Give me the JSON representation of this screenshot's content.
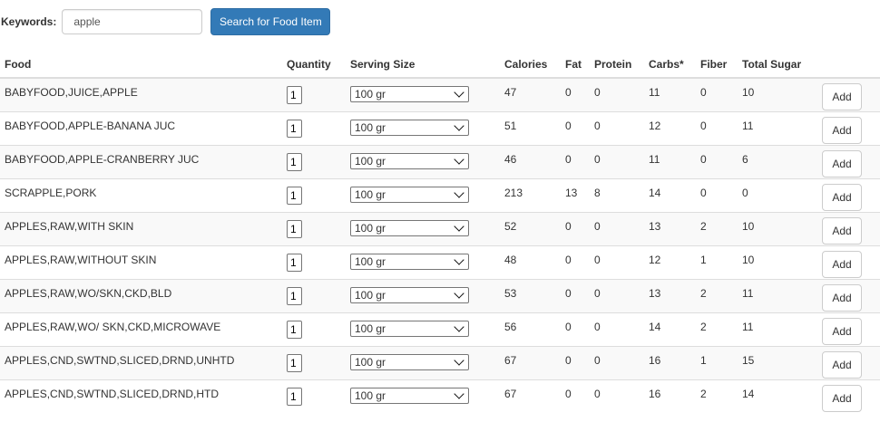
{
  "search": {
    "label": "Keywords:",
    "value": "apple",
    "button_label": "Search for Food Item"
  },
  "columns": {
    "food": "Food",
    "quantity": "Quantity",
    "serving_size": "Serving Size",
    "calories": "Calories",
    "fat": "Fat",
    "protein": "Protein",
    "carbs": "Carbs*",
    "fiber": "Fiber",
    "total_sugar": "Total Sugar"
  },
  "add_label": "Add",
  "rows": [
    {
      "food": "BABYFOOD,JUICE,APPLE",
      "quantity": "1",
      "serving": "100 gr",
      "calories": "47",
      "fat": "0",
      "protein": "0",
      "carbs": "11",
      "fiber": "0",
      "sugar": "10"
    },
    {
      "food": "BABYFOOD,APPLE-BANANA JUC",
      "quantity": "1",
      "serving": "100 gr",
      "calories": "51",
      "fat": "0",
      "protein": "0",
      "carbs": "12",
      "fiber": "0",
      "sugar": "11"
    },
    {
      "food": "BABYFOOD,APPLE-CRANBERRY JUC",
      "quantity": "1",
      "serving": "100 gr",
      "calories": "46",
      "fat": "0",
      "protein": "0",
      "carbs": "11",
      "fiber": "0",
      "sugar": "6"
    },
    {
      "food": "SCRAPPLE,PORK",
      "quantity": "1",
      "serving": "100 gr",
      "calories": "213",
      "fat": "13",
      "protein": "8",
      "carbs": "14",
      "fiber": "0",
      "sugar": "0"
    },
    {
      "food": "APPLES,RAW,WITH SKIN",
      "quantity": "1",
      "serving": "100 gr",
      "calories": "52",
      "fat": "0",
      "protein": "0",
      "carbs": "13",
      "fiber": "2",
      "sugar": "10"
    },
    {
      "food": "APPLES,RAW,WITHOUT SKIN",
      "quantity": "1",
      "serving": "100 gr",
      "calories": "48",
      "fat": "0",
      "protein": "0",
      "carbs": "12",
      "fiber": "1",
      "sugar": "10"
    },
    {
      "food": "APPLES,RAW,WO/SKN,CKD,BLD",
      "quantity": "1",
      "serving": "100 gr",
      "calories": "53",
      "fat": "0",
      "protein": "0",
      "carbs": "13",
      "fiber": "2",
      "sugar": "11"
    },
    {
      "food": "APPLES,RAW,WO/ SKN,CKD,MICROWAVE",
      "quantity": "1",
      "serving": "100 gr",
      "calories": "56",
      "fat": "0",
      "protein": "0",
      "carbs": "14",
      "fiber": "2",
      "sugar": "11"
    },
    {
      "food": "APPLES,CND,SWTND,SLICED,DRND,UNHTD",
      "quantity": "1",
      "serving": "100 gr",
      "calories": "67",
      "fat": "0",
      "protein": "0",
      "carbs": "16",
      "fiber": "1",
      "sugar": "15"
    },
    {
      "food": "APPLES,CND,SWTND,SLICED,DRND,HTD",
      "quantity": "1",
      "serving": "100 gr",
      "calories": "67",
      "fat": "0",
      "protein": "0",
      "carbs": "16",
      "fiber": "2",
      "sugar": "14"
    }
  ],
  "colors": {
    "primary_button": "#337ab7",
    "stripe": "#f9f9f9",
    "border": "#dddddd"
  }
}
